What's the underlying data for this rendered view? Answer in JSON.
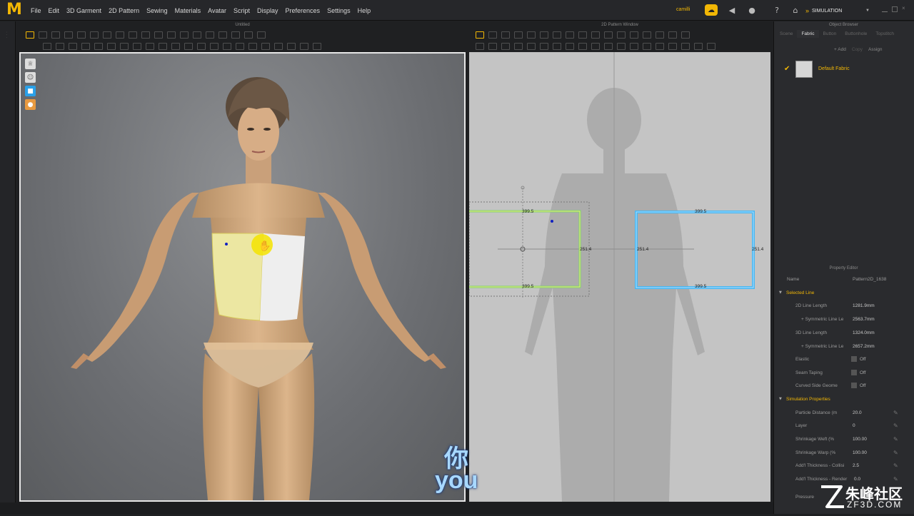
{
  "app": {
    "logo": "M",
    "menu": [
      "File",
      "Edit",
      "3D Garment",
      "2D Pattern",
      "Sewing",
      "Materials",
      "Avatar",
      "Script",
      "Display",
      "Preferences",
      "Settings",
      "Help"
    ],
    "user": "camilli",
    "mode": "SIMULATION",
    "accent_color": "#f2b705"
  },
  "panes": {
    "view3d_title": "Untitled",
    "view2d_title": "2D Pattern Window",
    "object_browser_title": "Object Browser",
    "property_editor_title": "Property Editor"
  },
  "pattern_labels": {
    "left_top": "399.5",
    "left_bottom": "399.5",
    "left_right": "251.4",
    "right_top": "399.5",
    "right_bottom": "399.5",
    "right_left": "251.4",
    "right_right": "251.4"
  },
  "object_browser": {
    "tabs": [
      "Scene",
      "Fabric",
      "Button",
      "Buttonhole",
      "Topstitch"
    ],
    "active_tab": "Fabric",
    "actions": [
      "+ Add",
      "Copy",
      "Assign"
    ],
    "fabric_name": "Default Fabric"
  },
  "property_editor": {
    "name_label": "Name",
    "name_value": "Pattern2D_1638",
    "selected_line": "Selected Line",
    "rows": [
      {
        "key": "2D Line Length",
        "value": "1281.9mm"
      },
      {
        "key": "+ Symmetric Line Le",
        "value": "2563.7mm"
      },
      {
        "key": "3D Line Length",
        "value": "1324.0mm"
      },
      {
        "key": "+ Symmetric Line Le",
        "value": "2657.2mm"
      }
    ],
    "toggles": [
      {
        "key": "Elastic",
        "value": "Off"
      },
      {
        "key": "Seam Taping",
        "value": "Off"
      },
      {
        "key": "Curved Side Geome",
        "value": "Off"
      }
    ],
    "simulation_properties": "Simulation Properties",
    "sim_rows": [
      {
        "key": "Particle Distance (m",
        "value": "20.0"
      },
      {
        "key": "Layer",
        "value": "0"
      },
      {
        "key": "Shrinkage Weft (%",
        "value": "100.00"
      },
      {
        "key": "Shrinkage Warp (%",
        "value": "100.00"
      },
      {
        "key": "Add'l Thickness - Collisi",
        "value": "2.5"
      },
      {
        "key": "Add'l Thickness - Render",
        "value": "0.0"
      }
    ],
    "pressure": "Pressure"
  },
  "subtitle": {
    "chinese": "你",
    "english": "you"
  },
  "watermark": {
    "text_cn": "朱峰社区",
    "text_en": "ZF3D.COM"
  }
}
